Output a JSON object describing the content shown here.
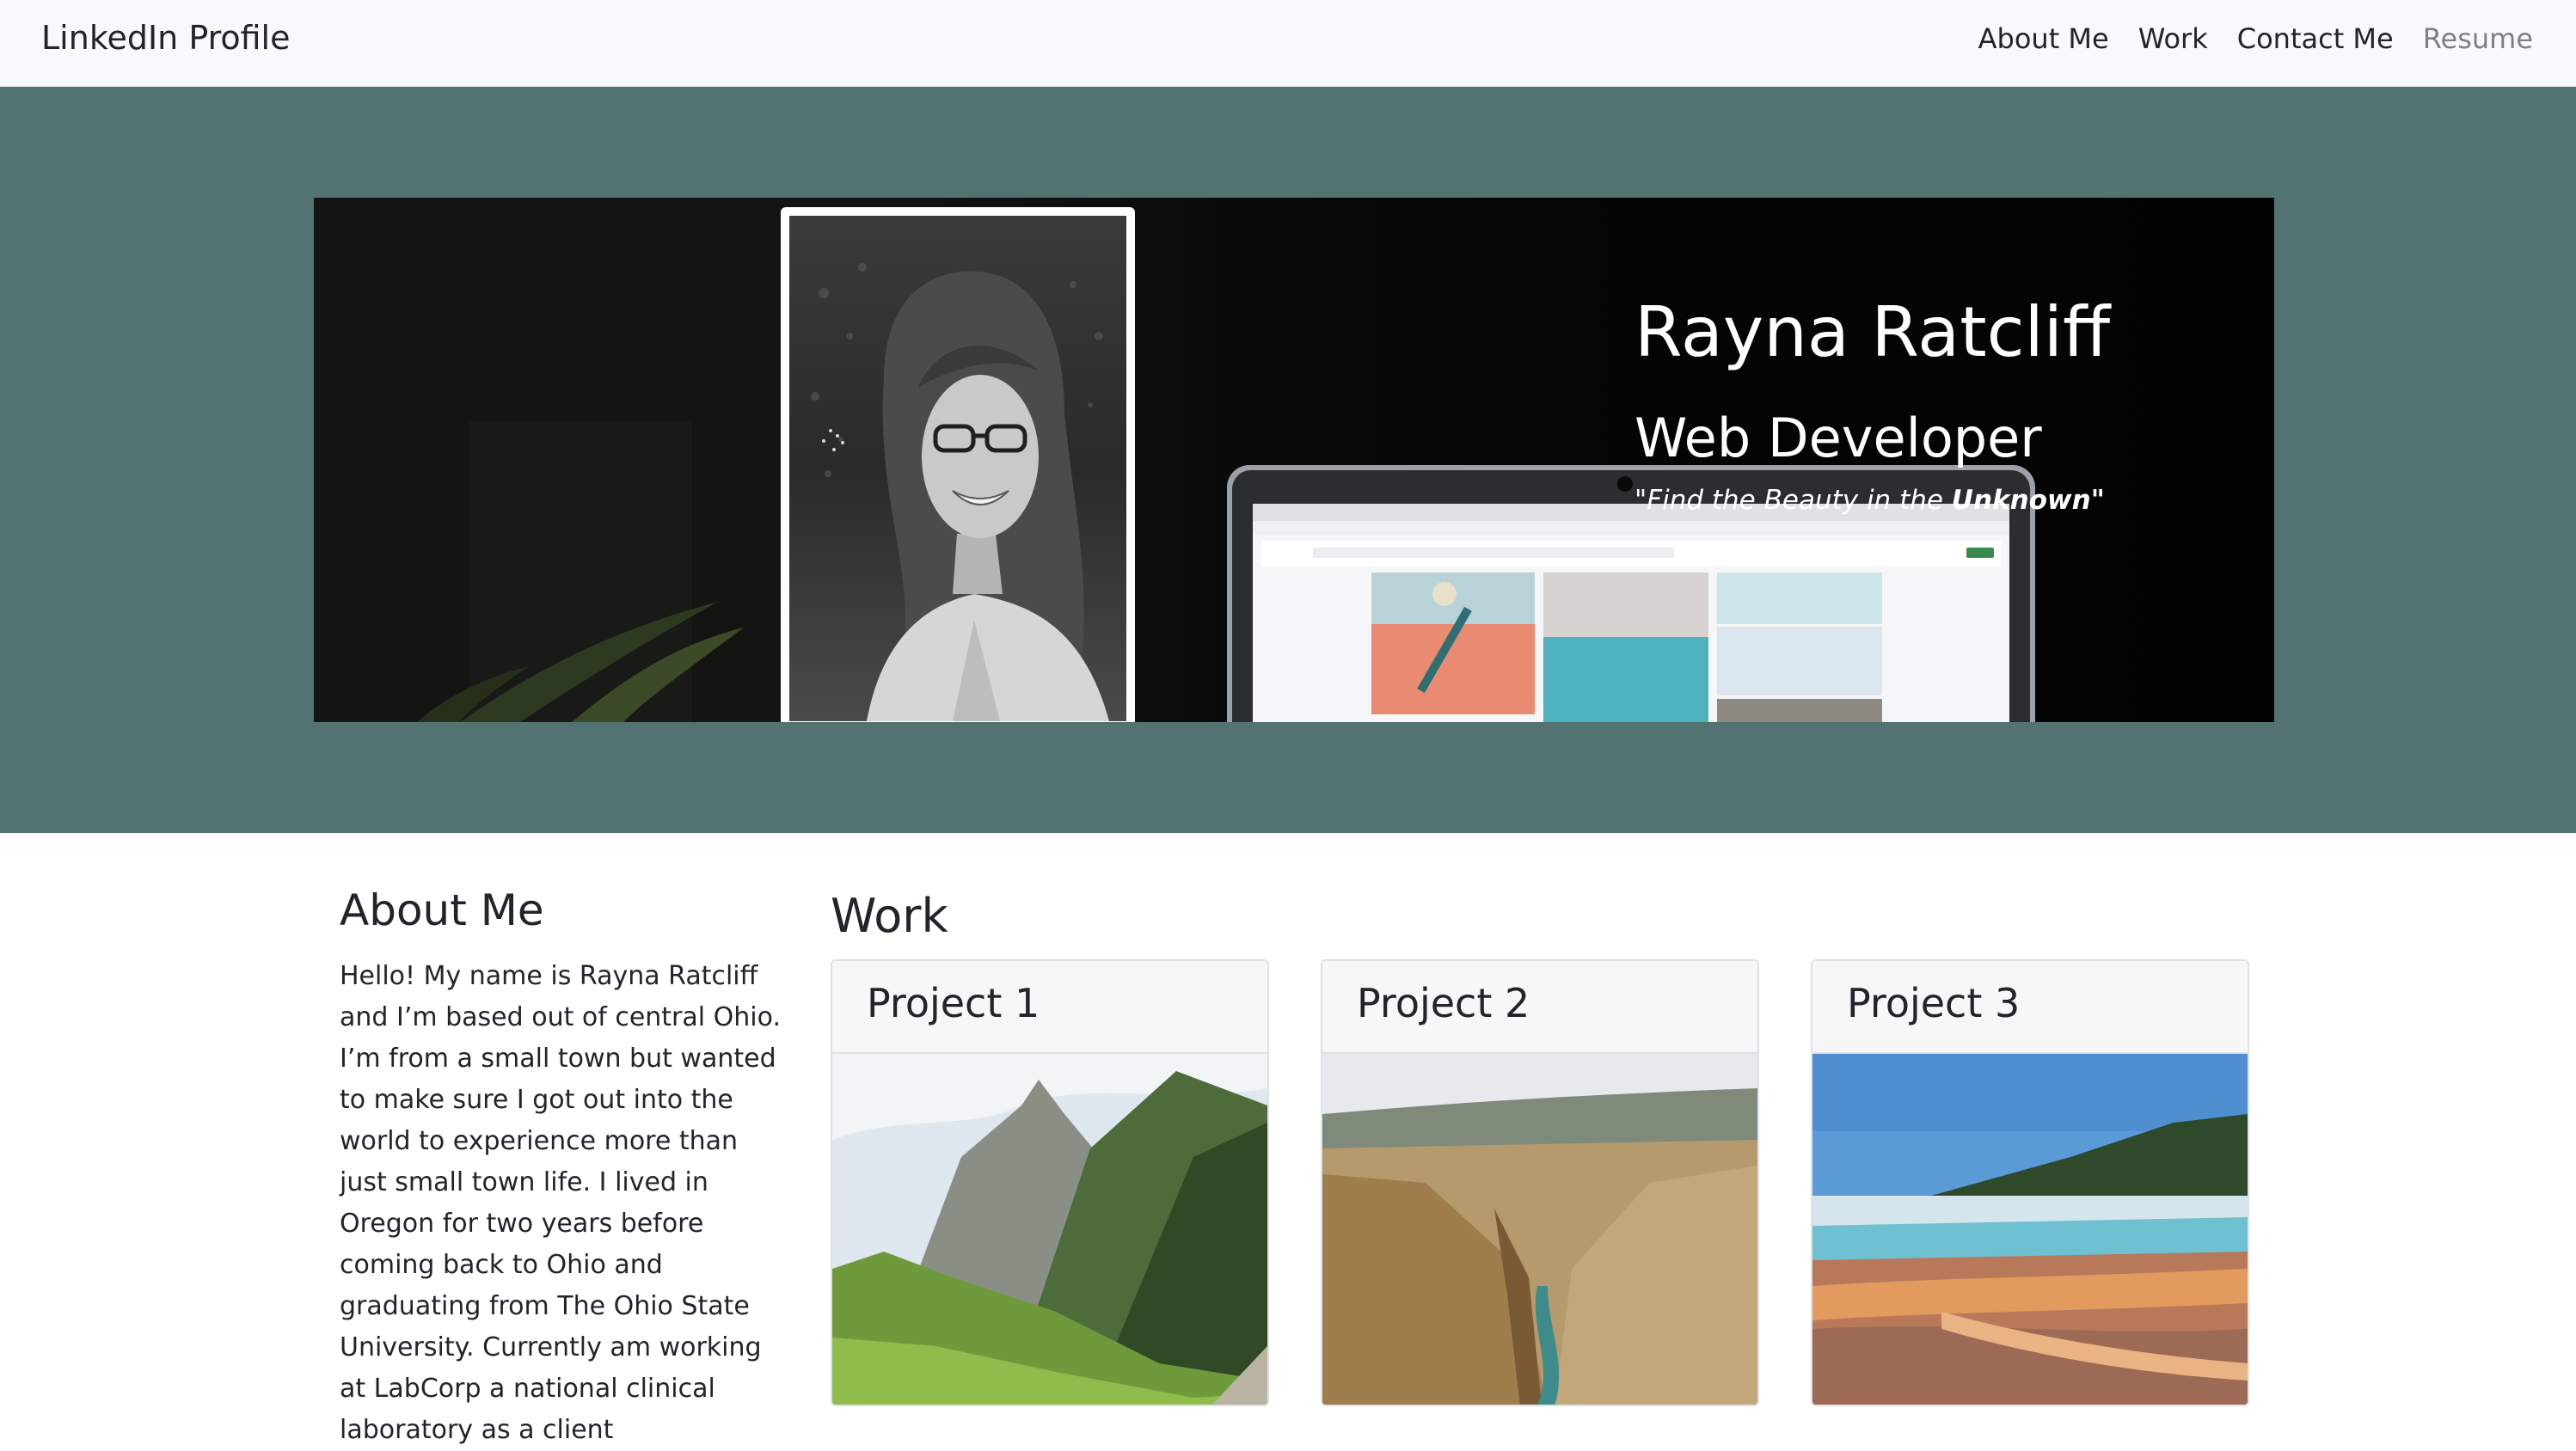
{
  "navbar": {
    "brand": "LinkedIn Profile",
    "links": [
      {
        "label": "About Me",
        "active": true
      },
      {
        "label": "Work",
        "active": true
      },
      {
        "label": "Contact Me",
        "active": true
      },
      {
        "label": "Resume",
        "active": false
      }
    ]
  },
  "hero": {
    "name": "Rayna Ratcliff",
    "title": "Web Developer",
    "quote_prefix": "\"Find the Beauty in the ",
    "quote_emphasis": "Unknown",
    "quote_suffix": "\""
  },
  "about": {
    "heading": "About Me",
    "text": "Hello! My name is Rayna Ratcliff and I’m based out of central Ohio. I’m from a small town but wanted to make sure I got out into the world to experience more than just small town life. I lived in Oregon for two years before coming back to Ohio and graduating from The Ohio State University. Currently am working at LabCorp a national clinical laboratory as a client"
  },
  "work": {
    "heading": "Work",
    "projects": [
      {
        "title": "Project 1"
      },
      {
        "title": "Project 2"
      },
      {
        "title": "Project 3"
      }
    ]
  },
  "colors": {
    "navbar_bg": "#f8f9fa",
    "hero_bg": "#527372",
    "text": "#212529",
    "muted_link": "#7c8186"
  }
}
